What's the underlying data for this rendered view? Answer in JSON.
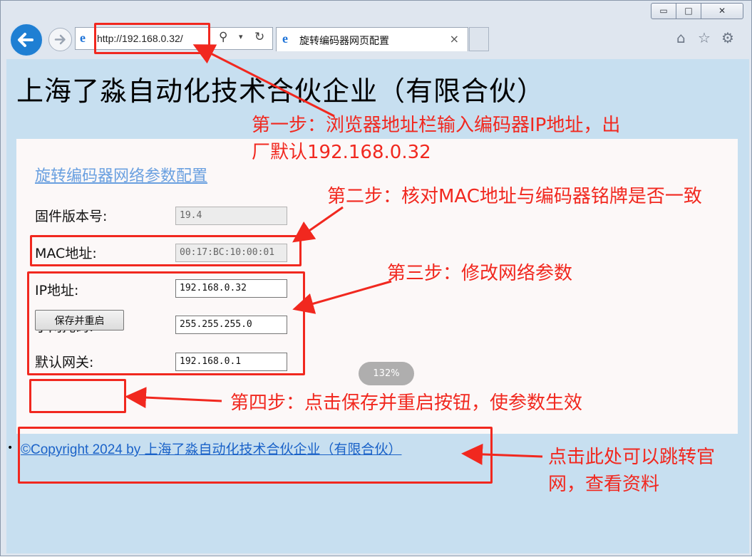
{
  "browser": {
    "address_url": "http://192.168.0.32/",
    "tab_title": "旋转编码器网页配置",
    "tab_close": "×",
    "window_controls": {
      "minimize": "▭",
      "maximize": "□",
      "close": "✕"
    },
    "toolbar_icons": [
      "back-arrow-icon",
      "forward-arrow-icon",
      "ie-logo-icon",
      "search-icon",
      "dropdown-icon",
      "refresh-icon",
      "home-icon",
      "favorites-star-icon",
      "settings-gear-icon"
    ],
    "zoom_indicator": "132%"
  },
  "page": {
    "company_heading": "上海了淼自动化技术合伙企业（有限合伙）",
    "config_title": "旋转编码器网络参数配置",
    "fields": {
      "firmware": {
        "label": "固件版本号:",
        "value": "19.4"
      },
      "mac": {
        "label": "MAC地址:",
        "value": "00:17:BC:10:00:01"
      },
      "ip": {
        "label": "IP地址:",
        "value": "192.168.0.32"
      },
      "subnet": {
        "label": "子网掩码:",
        "value": "255.255.255.0"
      },
      "gateway": {
        "label": "默认网关:",
        "value": "192.168.0.1"
      }
    },
    "save_button": "保存并重启",
    "copyright_link": "©Copyright 2024 by 上海了淼自动化技术合伙企业（有限合伙）"
  },
  "annotations": {
    "step1_line1": "第一步：浏览器地址栏输入编码器IP地址，出",
    "step1_line2": "厂默认192.168.0.32",
    "step2": "第二步：核对MAC地址与编码器铭牌是否一致",
    "step3": "第三步：修改网络参数",
    "step4": "第四步：点击保存并重启按钮，使参数生效",
    "step5_line1": "点击此处可以跳转官",
    "step5_line2": "网，查看资料",
    "color": "#f1281f"
  },
  "colors": {
    "page_background": "#c7dff0",
    "panel_background": "#fcf8f8",
    "link": "#1a62c8",
    "config_title": "#6aa0e0"
  }
}
